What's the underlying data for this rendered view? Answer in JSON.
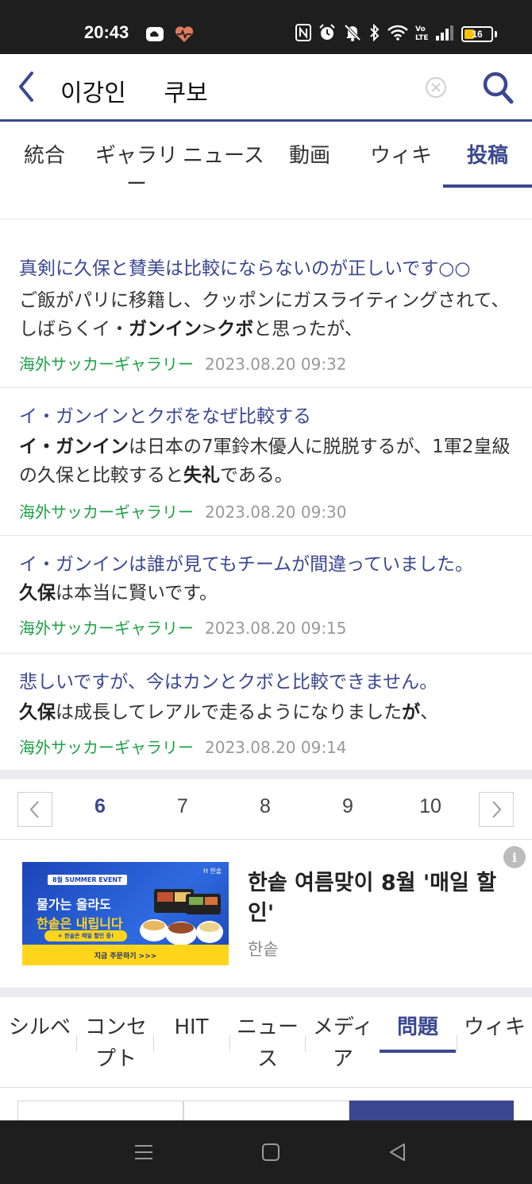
{
  "status_bar": {
    "time": "20:43",
    "battery": "16",
    "icons": [
      "cloud-icon",
      "heart-pulse-icon",
      "nfc-icon",
      "alarm-icon",
      "mute-icon",
      "bluetooth-icon",
      "wifi-icon",
      "volte-icon",
      "signal-icon",
      "battery-icon"
    ]
  },
  "search": {
    "query": "이강인     쿠보"
  },
  "tabs": [
    {
      "label": "統合"
    },
    {
      "label": "ギャラリー"
    },
    {
      "label": "ニュース"
    },
    {
      "label": "動画"
    },
    {
      "label": "ウィキ"
    },
    {
      "label": "投稿",
      "active": true
    }
  ],
  "results": [
    {
      "title": "真剣に久保と賛美は比較にならないのが正しいです○○",
      "body": [
        {
          "t": "ご飯がパリに移籍し、クッポンにガスライティングされて、しばらくイ・"
        },
        {
          "t": "ガンイン",
          "b": true
        },
        {
          "t": ">"
        },
        {
          "t": "クボ",
          "b": true
        },
        {
          "t": "と思ったが、"
        }
      ],
      "source": "海外サッカーギャラリー",
      "date": "2023.08.20 09:32"
    },
    {
      "title": "イ・ガンインとクボをなぜ比較する",
      "body": [
        {
          "t": "イ・ガンイン",
          "b": true
        },
        {
          "t": "は日本の7軍鈴木優人に脱脱するが、1軍2皇級の久保と比較すると"
        },
        {
          "t": "失礼",
          "b": true
        },
        {
          "t": "である。"
        }
      ],
      "source": "海外サッカーギャラリー",
      "date": "2023.08.20 09:30"
    },
    {
      "title": "イ・ガンインは誰が見てもチームが間違っていました。",
      "body": [
        {
          "t": "久保",
          "b": true
        },
        {
          "t": "は本当に賢いです。"
        }
      ],
      "source": "海外サッカーギャラリー",
      "date": "2023.08.20 09:15"
    },
    {
      "title": "悲しいですが、今はカンとクボと比較できません。",
      "body": [
        {
          "t": "久保",
          "b": true
        },
        {
          "t": "は成長してレアルで走るようになりました"
        },
        {
          "t": "が",
          "b": true
        },
        {
          "t": "、"
        }
      ],
      "source": "海外サッカーギャラリー",
      "date": "2023.08.20 09:14"
    }
  ],
  "pagination": {
    "pages": [
      "6",
      "7",
      "8",
      "9",
      "10"
    ],
    "current": "6"
  },
  "ad": {
    "title": "한솥 여름맞이 8월 '매일 할인'",
    "brand": "한솥",
    "info_label": "i",
    "image": {
      "logo": "H 한솥",
      "badge": "8월 SUMMER EVENT",
      "headline_1": "물가는 올라도",
      "headline_2": "한솥은 내립니다",
      "pill": "+ 한솥은 매일 할인 중!",
      "cta": "지금 주문하기 >>>"
    }
  },
  "category_tabs": [
    {
      "label": "シルベ"
    },
    {
      "label": "コンセプト"
    },
    {
      "label": "HIT"
    },
    {
      "label": "ニュース"
    },
    {
      "label": "メディア"
    },
    {
      "label": "問題",
      "active": true
    },
    {
      "label": "ウィキ"
    }
  ],
  "colors": {
    "accent": "#3b4890",
    "source_green": "#1ea045",
    "status_bar": "#1e1e1e"
  }
}
